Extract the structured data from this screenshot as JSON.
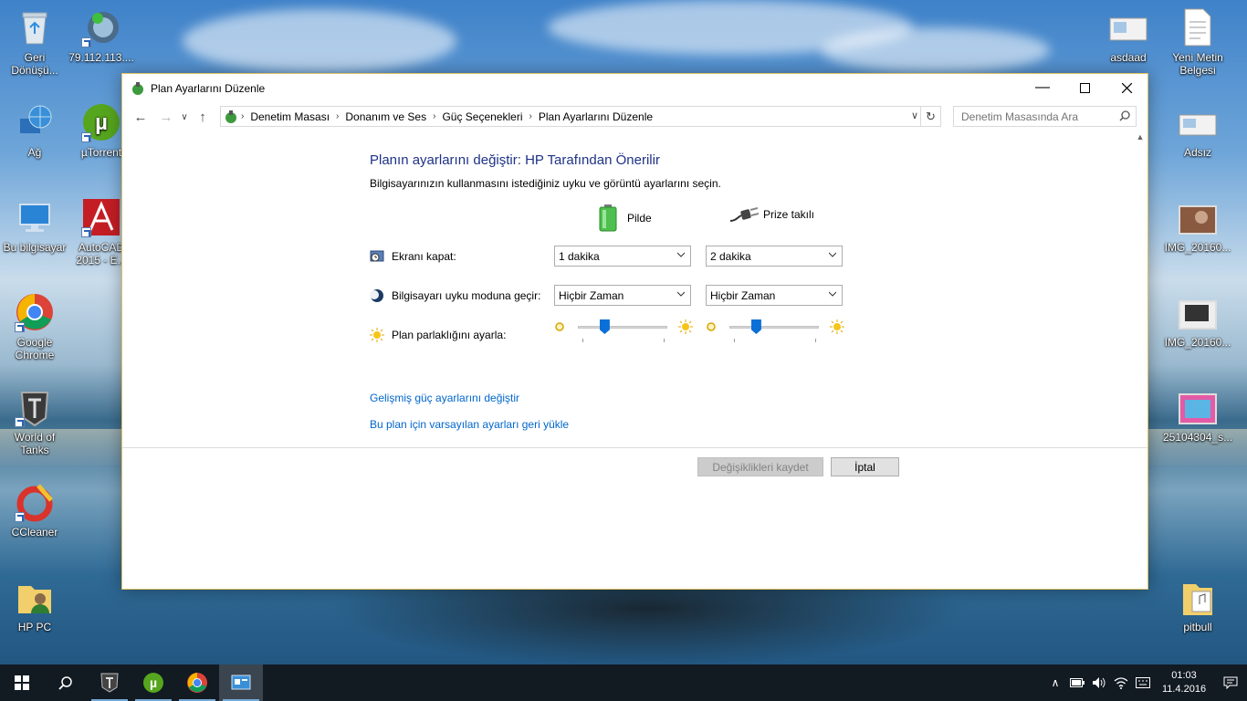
{
  "desktop": {
    "icons_left": [
      {
        "name": "recycle-bin",
        "label": "Geri Dönüşü..."
      },
      {
        "name": "server-shortcut",
        "label": "79.112.113...."
      },
      {
        "name": "network",
        "label": "Ağ"
      },
      {
        "name": "utorrent",
        "label": "µTorrent"
      },
      {
        "name": "this-pc",
        "label": "Bu bilgisayar"
      },
      {
        "name": "autocad",
        "label": "AutoCAD 2015 - E..."
      },
      {
        "name": "google-chrome",
        "label": "Google Chrome"
      },
      {
        "name": "world-of-tanks",
        "label": "World of Tanks"
      },
      {
        "name": "ccleaner",
        "label": "CCleaner"
      },
      {
        "name": "hp-pc",
        "label": "HP PC"
      }
    ],
    "icons_right": [
      {
        "name": "asdaad",
        "label": "asdaad"
      },
      {
        "name": "yeni-metin-belgesi",
        "label": "Yeni Metin Belgesi"
      },
      {
        "name": "adsiz",
        "label": "Adsız"
      },
      {
        "name": "img-1",
        "label": "IMG_20160..."
      },
      {
        "name": "img-2",
        "label": "IMG_20160..."
      },
      {
        "name": "img-3",
        "label": "25104304_s..."
      },
      {
        "name": "pitbull",
        "label": "pitbull"
      }
    ]
  },
  "window": {
    "title": "Plan Ayarlarını Düzenle",
    "breadcrumb": [
      "Denetim Masası",
      "Donanım ve Ses",
      "Güç Seçenekleri",
      "Plan Ayarlarını Düzenle"
    ],
    "search_placeholder": "Denetim Masasında Ara",
    "heading": "Planın ayarlarını değiştir: HP Tarafından Önerilir",
    "subtitle": "Bilgisayarınızın kullanmasını istediğiniz uyku ve görüntü ayarlarını seçin.",
    "columns": {
      "battery": "Pilde",
      "plugged": "Prize takılı"
    },
    "rows": {
      "display_off": {
        "label": "Ekranı kapat:",
        "battery": "1 dakika",
        "plugged": "2 dakika"
      },
      "sleep": {
        "label": "Bilgisayarı uyku moduna geçir:",
        "battery": "Hiçbir Zaman",
        "plugged": "Hiçbir Zaman"
      },
      "brightness": {
        "label": "Plan parlaklığını ayarla:",
        "battery_level": 0.3,
        "plugged_level": 0.3
      }
    },
    "links": {
      "advanced": "Gelişmiş güç ayarlarını değiştir",
      "restore": "Bu plan için varsayılan ayarları geri yükle"
    },
    "buttons": {
      "save": "Değişiklikleri kaydet",
      "cancel": "İptal"
    }
  },
  "taskbar": {
    "clock_time": "01:03",
    "clock_date": "11.4.2016"
  },
  "colors": {
    "heading": "#1e3287",
    "link": "#0066cc",
    "slider_thumb": "#0a6fd6",
    "taskbar": "#121a22"
  }
}
